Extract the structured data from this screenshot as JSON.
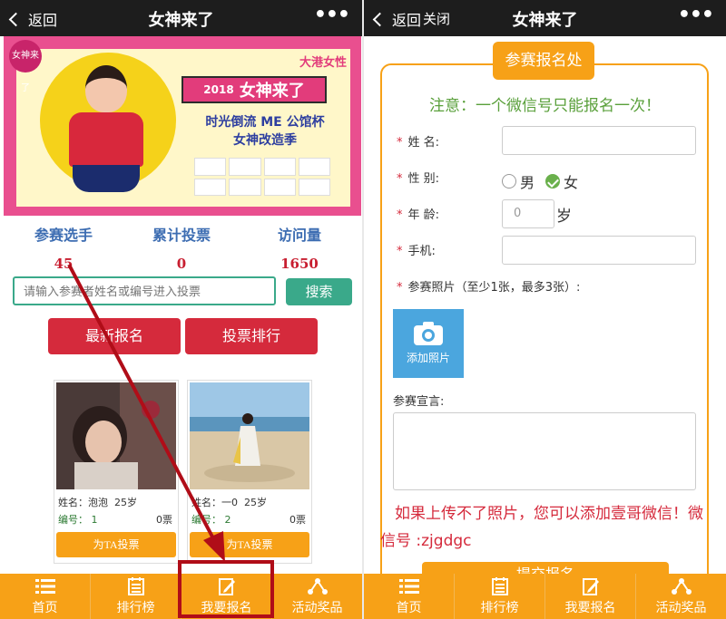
{
  "left": {
    "titlebar": {
      "back_label": "返回",
      "title": "女神来了"
    },
    "banner": {
      "brand": "大港女性",
      "sticker": "女神来了",
      "year": "2018",
      "headline": "女神来了",
      "sub1": "时光倒流 ME 公馆杯",
      "sub2": "女神改造季"
    },
    "stats": [
      {
        "label": "参赛选手",
        "value": "45"
      },
      {
        "label": "累计投票",
        "value": "0"
      },
      {
        "label": "访问量",
        "value": "1650"
      }
    ],
    "search": {
      "placeholder": "请输入参赛者姓名或编号进入投票",
      "button": "搜索"
    },
    "tabs": {
      "latest": "最新报名",
      "ranking": "投票排行"
    },
    "cards": [
      {
        "name_label": "姓名：",
        "name": "泡泡",
        "age": "25岁",
        "num_label": "编号：",
        "num": "1",
        "votes": "0票",
        "vote_btn": "为TA投票"
      },
      {
        "name_label": "姓名：",
        "name": "一0",
        "age": "25岁",
        "num_label": "编号：",
        "num": "2",
        "votes": "0票",
        "vote_btn": "为TA投票"
      }
    ],
    "nav": [
      "首页",
      "排行榜",
      "我要报名",
      "活动奖品"
    ]
  },
  "right": {
    "titlebar": {
      "back_label": "返回",
      "close_label": "关闭",
      "title": "女神来了"
    },
    "form_title": "参赛报名处",
    "notice": "注意：一个微信号只能报名一次！",
    "fields": {
      "name": "姓 名:",
      "gender": "性 别:",
      "male": "男",
      "female": "女",
      "age": "年 龄:",
      "age_value": "0",
      "age_unit": "岁",
      "phone": "手机:",
      "photos": "参赛照片（至少1张，最多3张）:",
      "add_photo": "添加照片",
      "declaration": "参赛宣言:"
    },
    "hint": "如果上传不了照片，您可以添加壹哥微信！微信号 :zjgdgc",
    "submit": "提交报名",
    "nav": [
      "首页",
      "排行榜",
      "我要报名",
      "活动奖品"
    ]
  },
  "colors": {
    "accent": "#f7a117",
    "red": "#d52a3c",
    "teal": "#3aa98a",
    "stat_label": "#3d6db2",
    "notice": "#5aa03b"
  }
}
